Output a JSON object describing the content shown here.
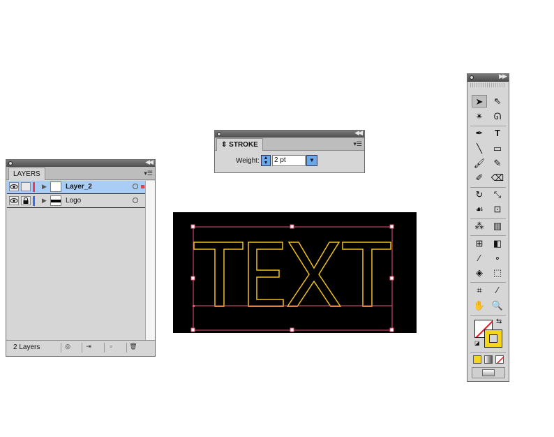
{
  "layers_panel": {
    "tab_label": "LAYERS",
    "rows": [
      {
        "name": "Layer_2",
        "color": "#ef3b52",
        "selected": true
      },
      {
        "name": "Logo",
        "color": "#3b6cf0",
        "selected": false
      }
    ],
    "footer_count": "2 Layers"
  },
  "stroke_panel": {
    "tab_label": "STROKE",
    "weight_label": "Weight:",
    "weight_value": "2 pt"
  },
  "artwork": {
    "text": "TEXT",
    "stroke_color": "#f2c21b",
    "background": "#000000",
    "selection_color": "#e8547a"
  },
  "tools_panel": {
    "fill_color": "#f5d51d",
    "tool_icons": [
      "selection-icon",
      "direct-selection-icon",
      "magic-wand-icon",
      "lasso-icon",
      "pen-icon",
      "type-icon",
      "line-icon",
      "rectangle-icon",
      "paintbrush-icon",
      "pencil-icon",
      "blob-brush-icon",
      "eraser-icon",
      "rotate-icon",
      "scale-icon",
      "warp-icon",
      "free-transform-icon",
      "symbol-sprayer-icon",
      "column-graph-icon",
      "mesh-icon",
      "gradient-icon",
      "eyedropper-icon",
      "blend-icon",
      "live-paint-bucket-icon",
      "live-paint-selection-icon",
      "artboard-icon",
      "slice-icon",
      "hand-icon",
      "zoom-icon"
    ]
  }
}
